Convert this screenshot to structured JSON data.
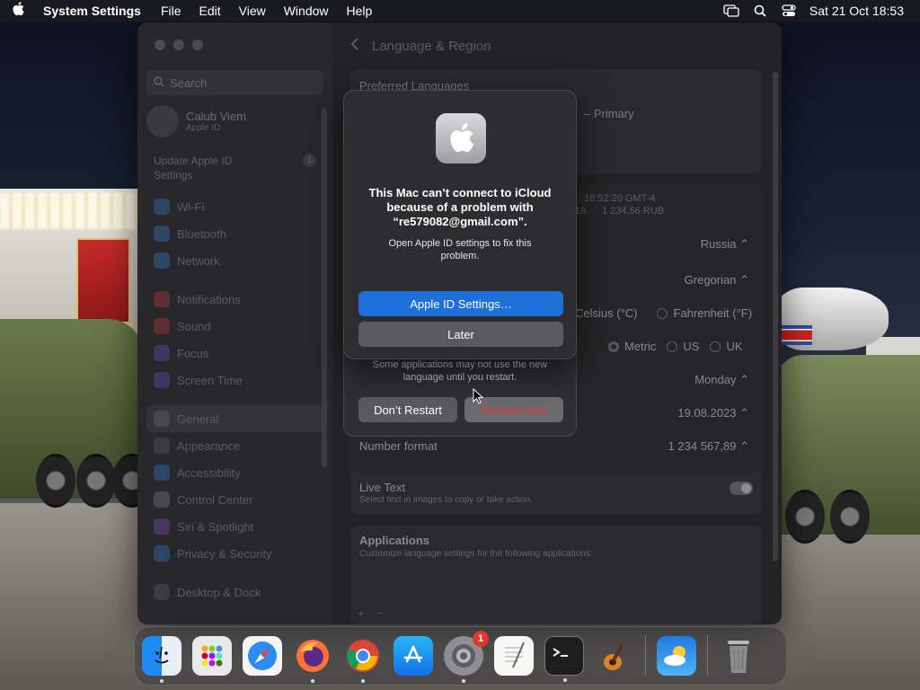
{
  "menubar": {
    "app_name": "System Settings",
    "menus": [
      "File",
      "Edit",
      "View",
      "Window",
      "Help"
    ],
    "datetime": "Sat 21 Oct  18:53"
  },
  "window": {
    "search_placeholder": "Search",
    "profile": {
      "name": "Calub Viem",
      "sub": "Apple ID"
    },
    "update": {
      "label": "Update Apple ID Settings",
      "badge": "1"
    },
    "sidebar_items": [
      {
        "label": "Wi-Fi",
        "icon": "wifi-icon"
      },
      {
        "label": "Bluetooth",
        "icon": "bluetooth-icon"
      },
      {
        "label": "Network",
        "icon": "network-icon"
      },
      {
        "label": "Notifications",
        "icon": "notifications-icon"
      },
      {
        "label": "Sound",
        "icon": "sound-icon"
      },
      {
        "label": "Focus",
        "icon": "focus-icon"
      },
      {
        "label": "Screen Time",
        "icon": "screen-time-icon"
      },
      {
        "label": "General",
        "icon": "gear-icon"
      },
      {
        "label": "Appearance",
        "icon": "appearance-icon"
      },
      {
        "label": "Accessibility",
        "icon": "accessibility-icon"
      },
      {
        "label": "Control Center",
        "icon": "control-center-icon"
      },
      {
        "label": "Siri & Spotlight",
        "icon": "siri-icon"
      },
      {
        "label": "Privacy & Security",
        "icon": "privacy-icon"
      },
      {
        "label": "Desktop & Dock",
        "icon": "desktop-dock-icon"
      }
    ],
    "content": {
      "title": "Language & Region",
      "preferred_languages": "Preferred Languages",
      "primary_label": "– Primary",
      "time_sample": "18:52:20 GMT-4",
      "sample_tail": "19",
      "currency_sample": "1 234,56 RUB",
      "region_value": "Russia",
      "calendar_value": "Gregorian",
      "temp_celsius": "Celsius (°C)",
      "temp_fahrenheit": "Fahrenheit (°F)",
      "measure_metric": "Metric",
      "measure_us": "US",
      "measure_uk": "UK",
      "first_day_value": "Monday",
      "date_format_value": "19.08.2023",
      "number_format_label": "Number format",
      "number_format_value": "1 234 567,89",
      "live_text_title": "Live Text",
      "live_text_sub": "Select text in images to copy or take action.",
      "applications_title": "Applications",
      "applications_sub": "Customize language settings for the following applications:",
      "add_label": "+",
      "remove_label": "−"
    }
  },
  "dialog": {
    "title": "This Mac can’t connect to iCloud because of a problem with “re579082@gmail.com”.",
    "message": "Open Apple ID settings to fix this problem.",
    "primary_button": "Apple ID Settings…",
    "secondary_button": "Later"
  },
  "restart_dialog": {
    "message": "Some applications may not use the new language until you restart.",
    "dont_restart": "Don’t Restart",
    "restart_now": "Restart Now"
  },
  "dock": {
    "settings_badge": "1"
  }
}
